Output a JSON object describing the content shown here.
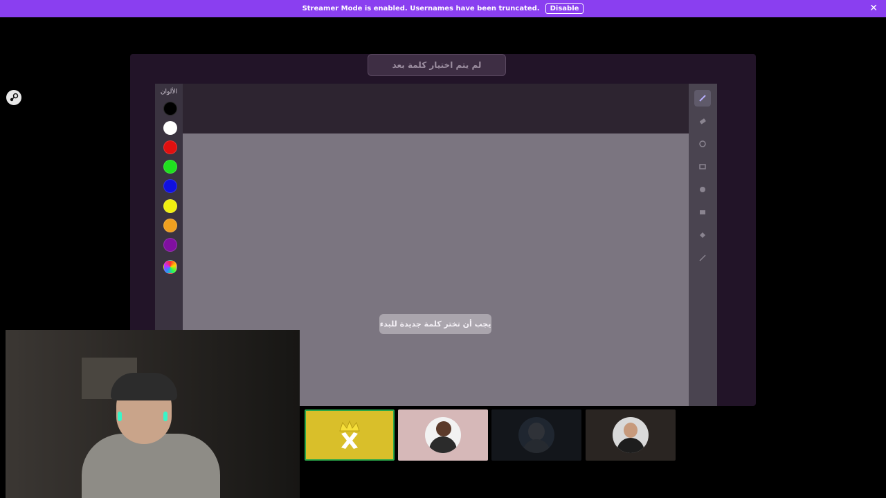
{
  "banner": {
    "text": "Streamer Mode is enabled. Usernames have been truncated.",
    "disable_label": "Disable",
    "close_icon": "close-icon",
    "background": "#8a3ff0"
  },
  "sidebar": {
    "icon": "steam-icon"
  },
  "game": {
    "word_status": "لم يتم اختيار كلمة بعد",
    "colors_title": "الألوان",
    "colors": [
      "#000000",
      "#ffffff",
      "#e01010",
      "#1fe01f",
      "#1010e0",
      "#f0f010",
      "#f0a020",
      "#8010a0"
    ],
    "custom_color_icon": "color-wheel-icon",
    "canvas_message": "يجب أن تختر كلمة جديدة للبدء",
    "tools": [
      {
        "icon": "pencil-icon",
        "active": true
      },
      {
        "icon": "eraser-icon",
        "active": false
      },
      {
        "icon": "circle-outline-icon",
        "active": false
      },
      {
        "icon": "rectangle-outline-icon",
        "active": false
      },
      {
        "icon": "circle-filled-icon",
        "active": false
      },
      {
        "icon": "rectangle-filled-icon",
        "active": false
      },
      {
        "icon": "fill-bucket-icon",
        "active": false
      },
      {
        "icon": "line-icon",
        "active": false
      }
    ]
  },
  "players": [
    {
      "icon": "crown-x-icon",
      "background": "#d9bf2a",
      "highlighted": true
    },
    {
      "icon": "avatar-icon",
      "background": "#d6b8b8",
      "highlighted": false
    },
    {
      "icon": "avatar-icon",
      "background": "#13161b",
      "highlighted": false
    },
    {
      "icon": "avatar-icon",
      "background": "#2a2522",
      "highlighted": false
    }
  ]
}
